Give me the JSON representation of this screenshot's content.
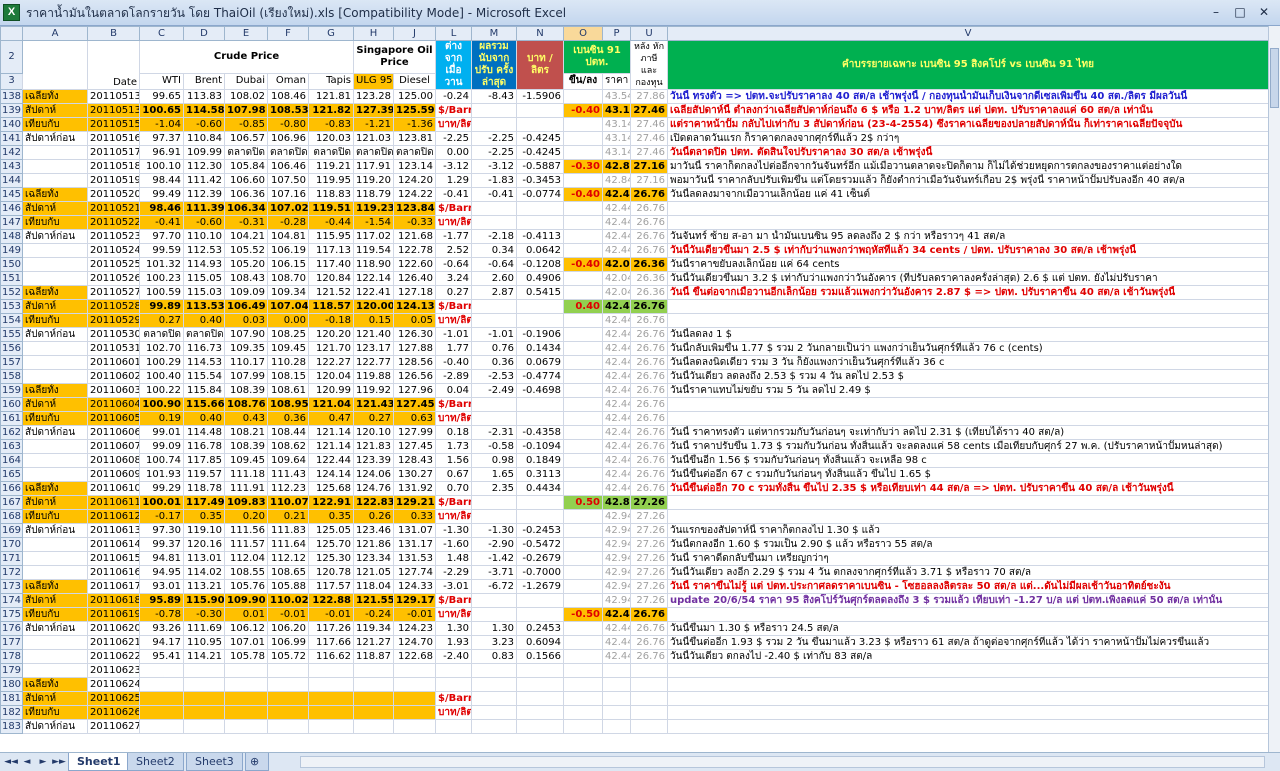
{
  "window": {
    "title": "ราคาน้ำมันในตลาดโลกรายวัน โดย ThaiOil (เรียงใหม่).xls  [Compatibility Mode] - Microsoft Excel",
    "app_icon": "X",
    "minimize": "–",
    "maximize": "□",
    "close": "✕"
  },
  "columns": [
    "A",
    "B",
    "C",
    "D",
    "E",
    "F",
    "G",
    "H",
    "J",
    "L",
    "M",
    "N",
    "O",
    "P",
    "U",
    "V"
  ],
  "header": {
    "r2": "2",
    "r3": "3",
    "crude": "Crude Price",
    "singapore": "Singapore Oil Price",
    "date": "Date",
    "wti": "WTI",
    "brent": "Brent",
    "dubai": "Dubai",
    "oman": "Oman",
    "tapis": "Tapis",
    "ulg": "ULG 95",
    "diesel": "Diesel",
    "diff": "ต่าง จาก เมื่อ วาน",
    "cum": "ผลรวม นับจาก ปรับ ครั้ง ล่าสุด",
    "baht": "บาท / ลิตร",
    "b91": "เบนซิน 91 ปตท.",
    "updown": "ขึ้น/ลง",
    "price": "ราคา",
    "u": "หลัง หัก ภาษี และ กองทุน",
    "v": "คำบรรยายเฉพาะ เบนซิน 95 สิงคโปร์ vs เบนซิน 91 ไทย"
  },
  "rows": [
    [
      "138",
      "เฉลี่ยทั้ง",
      "20110513",
      "99.65",
      "113.83",
      "108.02",
      "108.46",
      "121.81",
      "123.28",
      "125.00",
      "-0.24",
      "-8.43",
      "-1.5906",
      "",
      "43.54",
      "27.86",
      "วันนี้ ทรงตัว => ปตท.จะปรับราคาลง 40 สต/ล เช้าพรุ่งนี้ / กองทุนน้ำมันเก็บเงินจากดีเซลเพิ่มขึ้น 40 สต./ลิตร มีผลวันนี้"
    ],
    [
      "139",
      "สัปดาห์",
      "20110513",
      "100.65",
      "114.58",
      "107.98",
      "108.53",
      "121.82",
      "127.39",
      "125.59",
      "$/Barrel",
      "",
      "",
      "-0.40",
      "43.14",
      "27.46",
      "เฉลี่ยสัปดาห์นี้ ต่ำลงกว่าเฉลี่ยสัปดาห์ก่อนถึง 6 $ หรือ 1.2 บาท/ลิตร แต่ ปตท. ปรับราคาลงแค่ 60 สต/ล เท่านั้น"
    ],
    [
      "140",
      "เทียบกับ",
      "20110515",
      "-1.04",
      "-0.60",
      "-0.85",
      "-0.80",
      "-0.83",
      "-1.21",
      "-1.36",
      "บาท/ลิตร",
      "",
      "",
      "",
      "43.14",
      "27.46",
      "แต่ราคาหน้าปั๊ม กลับไปเท่ากับ 3 สัปดาห์ก่อน (23-4-2554) ซึ่งราคาเฉลี่ยของปลายสัปดาห์นั้น ก็เท่าราคาเฉลี่ยปัจจุบัน"
    ],
    [
      "141",
      "สัปดาห์ก่อน",
      "20110516",
      "97.37",
      "110.84",
      "106.57",
      "106.96",
      "120.03",
      "121.03",
      "123.81",
      "-2.25",
      "-2.25",
      "-0.4245",
      "",
      "43.14",
      "27.46",
      "เปิดตลาดวันแรก ก็ราคาตกลงจากศุกร์ที่แล้ว 2$ กว่าๆ"
    ],
    [
      "142",
      "",
      "20110517",
      "96.91",
      "109.99",
      "ตลาดปิด",
      "ตลาดปิด",
      "ตลาดปิด",
      "ตลาดปิด",
      "ตลาดปิด",
      "0.00",
      "-2.25",
      "-0.4245",
      "",
      "43.14",
      "27.46",
      "วันนี้ตลาดปิด  ปตท. ตัดสินใจปรับราคาลง 30 สต/ล เช้าพรุ่งนี้"
    ],
    [
      "143",
      "",
      "20110518",
      "100.10",
      "112.30",
      "105.84",
      "106.46",
      "119.21",
      "117.91",
      "123.14",
      "-3.12",
      "-3.12",
      "-0.5887",
      "-0.30",
      "42.84",
      "27.16",
      "มาวันนี้ ราคาก็ตกลงไปต่ออีกจากวันจันทร์อีก แม้เมื่อวานตลาดจะปิดก็ตาม ก็ไม่ได้ช่วยหยุดการตกลงของราคาแต่อย่างใด"
    ],
    [
      "144",
      "",
      "20110519",
      "98.44",
      "111.42",
      "106.60",
      "107.50",
      "119.95",
      "119.20",
      "124.20",
      "1.29",
      "-1.83",
      "-0.3453",
      "",
      "42.84",
      "27.16",
      "พอมาวันนี้ ราคากลับปรับเพิ่มขึ้น แต่โดยรวมแล้ว ก็ยังต่ำกว่าเมื่อวันจันทร์เกือบ 2$  พรุ่งนี้ ราคาหน้าปั๊มปรับลงอีก 40 สต/ล"
    ],
    [
      "145",
      "เฉลี่ยทั้ง",
      "20110520",
      "99.49",
      "112.39",
      "106.36",
      "107.16",
      "118.83",
      "118.79",
      "124.22",
      "-0.41",
      "-0.41",
      "-0.0774",
      "-0.40",
      "42.44",
      "26.76",
      "วันนี้ลดลงมาจากเมื่อวานเล็กน้อย แค่ 41 เซ็นต์"
    ],
    [
      "146",
      "สัปดาห์",
      "20110521",
      "98.46",
      "111.39",
      "106.34",
      "107.02",
      "119.51",
      "119.23",
      "123.84",
      "$/Barrel",
      "",
      "",
      "",
      "42.44",
      "26.76",
      ""
    ],
    [
      "147",
      "เทียบกับ",
      "20110522",
      "-0.41",
      "-0.60",
      "-0.31",
      "-0.28",
      "-0.44",
      "-1.54",
      "-0.33",
      "บาท/ลิตร",
      "",
      "",
      "",
      "42.44",
      "26.76",
      ""
    ],
    [
      "148",
      "สัปดาห์ก่อน",
      "20110523",
      "97.70",
      "110.10",
      "104.21",
      "104.81",
      "115.95",
      "117.02",
      "121.68",
      "-1.77",
      "-2.18",
      "-0.4113",
      "",
      "42.44",
      "26.76",
      "วันจันทร์ ซ้าย ส-อา มา น้ำมันเบนซิน 95 ลดลงถึง 2 $ กว่า หรือราวๆ 41 สต/ล"
    ],
    [
      "149",
      "",
      "20110524",
      "99.59",
      "112.53",
      "105.52",
      "106.19",
      "117.13",
      "119.54",
      "122.78",
      "2.52",
      "0.34",
      "0.0642",
      "",
      "42.44",
      "26.76",
      "วันนี้วันเดียวขึ้นมา 2.5 $ เท่ากับว่าแพงกว่าพฤหัสที่แล้ว 34 cents / ปตท. ปรับราคาลง 30 สต/ล เช้าพรุ่งนี้"
    ],
    [
      "150",
      "",
      "20110525",
      "101.32",
      "114.93",
      "105.20",
      "106.15",
      "117.40",
      "118.90",
      "122.60",
      "-0.64",
      "-0.64",
      "-0.1208",
      "-0.40",
      "42.04",
      "26.36",
      "วันนี้ราคาขยับลงเล็กน้อย แค่ 64 cents"
    ],
    [
      "151",
      "",
      "20110526",
      "100.23",
      "115.05",
      "108.43",
      "108.70",
      "120.84",
      "122.14",
      "126.40",
      "3.24",
      "2.60",
      "0.4906",
      "",
      "42.04",
      "26.36",
      "วันนี้วันเดียวขึ้นมา 3.2 $ เท่ากับว่าแพงกว่าวันอังคาร (ที่ปรับลดราคาลงครั้งล่าสุด) 2.6 $ แต่ ปตท. ยังไม่ปรับราคา"
    ],
    [
      "152",
      "เฉลี่ยทั้ง",
      "20110527",
      "100.59",
      "115.03",
      "109.09",
      "109.34",
      "121.52",
      "122.41",
      "127.18",
      "0.27",
      "2.87",
      "0.5415",
      "",
      "42.04",
      "26.36",
      "วันนี้ ขึ้นต่อจากเมื่อวานอีกเล็กน้อย รวมแล้วแพงกว่าวันอังคาร 2.87 $ => ปตท. ปรับราคาขึ้น 40 สต/ล เช้าวันพรุ่งนี้"
    ],
    [
      "153",
      "สัปดาห์",
      "20110528",
      "99.89",
      "113.53",
      "106.49",
      "107.04",
      "118.57",
      "120.00",
      "124.13",
      "$/Barrel",
      "",
      "",
      "0.40",
      "42.44",
      "26.76",
      ""
    ],
    [
      "154",
      "เทียบกับ",
      "20110529",
      "0.27",
      "0.40",
      "0.03",
      "0.00",
      "-0.18",
      "0.15",
      "0.05",
      "บาท/ลิตร",
      "",
      "",
      "",
      "42.44",
      "26.76",
      ""
    ],
    [
      "155",
      "สัปดาห์ก่อน",
      "20110530",
      "ตลาดปิด",
      "ตลาดปิด",
      "107.90",
      "108.25",
      "120.20",
      "121.40",
      "126.30",
      "-1.01",
      "-1.01",
      "-0.1906",
      "",
      "42.44",
      "26.76",
      "วันนี้ลดลง 1 $"
    ],
    [
      "156",
      "",
      "20110531",
      "102.70",
      "116.73",
      "109.35",
      "109.45",
      "121.70",
      "123.17",
      "127.88",
      "1.77",
      "0.76",
      "0.1434",
      "",
      "42.44",
      "26.76",
      "วันนี้กลับเพิ่มขึ้น 1.77 $ รวม 2 วันกลายเป็นว่า แพงกว่าเย็นวันศุกร์ที่แล้ว 76 c (cents)"
    ],
    [
      "157",
      "",
      "20110601",
      "100.29",
      "114.53",
      "110.17",
      "110.28",
      "122.27",
      "122.77",
      "128.56",
      "-0.40",
      "0.36",
      "0.0679",
      "",
      "42.44",
      "26.76",
      "วันนี้ลดลงนิดเดียว รวม 3 วัน ก็ยังแพงกว่าเย็นวันศุกร์ที่แล้ว 36 c"
    ],
    [
      "158",
      "",
      "20110602",
      "100.40",
      "115.54",
      "107.99",
      "108.15",
      "120.04",
      "119.88",
      "126.56",
      "-2.89",
      "-2.53",
      "-0.4774",
      "",
      "42.44",
      "26.76",
      "วันนี้วันเดียว ลดลงถึง 2.53 $ รวม 4 วัน ลดไป 2.53 $"
    ],
    [
      "159",
      "เฉลี่ยทั้ง",
      "20110603",
      "100.22",
      "115.84",
      "108.39",
      "108.61",
      "120.99",
      "119.92",
      "127.96",
      "0.04",
      "-2.49",
      "-0.4698",
      "",
      "42.44",
      "26.76",
      "วันนี้ราคาแทบไม่ขยับ  รวม 5 วัน ลดไป 2.49 $"
    ],
    [
      "160",
      "สัปดาห์",
      "20110604",
      "100.90",
      "115.66",
      "108.76",
      "108.95",
      "121.04",
      "121.43",
      "127.45",
      "$/Barrel",
      "",
      "",
      "",
      "42.44",
      "26.76",
      ""
    ],
    [
      "161",
      "เทียบกับ",
      "20110605",
      "0.19",
      "0.40",
      "0.43",
      "0.36",
      "0.47",
      "0.27",
      "0.63",
      "บาท/ลิตร",
      "",
      "",
      "",
      "42.44",
      "26.76",
      ""
    ],
    [
      "162",
      "สัปดาห์ก่อน",
      "20110606",
      "99.01",
      "114.48",
      "108.21",
      "108.44",
      "121.14",
      "120.10",
      "127.99",
      "0.18",
      "-2.31",
      "-0.4358",
      "",
      "42.44",
      "26.76",
      "วันนี้ ราคาทรงตัว แต่หากรวมกับวันก่อนๆ จะเท่ากับว่า ลดไป 2.31 $ (เทียบได้ราว 40 สต/ล)"
    ],
    [
      "163",
      "",
      "20110607",
      "99.09",
      "116.78",
      "108.39",
      "108.62",
      "121.14",
      "121.83",
      "127.45",
      "1.73",
      "-0.58",
      "-0.1094",
      "",
      "42.44",
      "26.76",
      "วันนี้ ราคาปรับขึ้น 1.73 $ รวมกับวันก่อน ทั้งสิ้นแล้ว จะลดลงแค่ 58 cents เมื่อเทียบกับศุกร์ 27 พ.ค. (ปรับราคาหน้าปั๊มหนล่าสุด)"
    ],
    [
      "164",
      "",
      "20110608",
      "100.74",
      "117.85",
      "109.45",
      "109.64",
      "122.44",
      "123.39",
      "128.43",
      "1.56",
      "0.98",
      "0.1849",
      "",
      "42.44",
      "26.76",
      "วันนี้ขึ้นอีก 1.56 $ รวมกับวันก่อนๆ ทั้งสิ้นแล้ว จะเหลือ 98 c"
    ],
    [
      "165",
      "",
      "20110609",
      "101.93",
      "119.57",
      "111.18",
      "111.43",
      "124.14",
      "124.06",
      "130.27",
      "0.67",
      "1.65",
      "0.3113",
      "",
      "42.44",
      "26.76",
      "วันนี้ขึ้นต่ออีก 67 c  รวมกับวันก่อนๆ ทั้งสิ้นแล้ว ขึ้นไป 1.65 $"
    ],
    [
      "166",
      "เฉลี่ยทั้ง",
      "20110610",
      "99.29",
      "118.78",
      "111.91",
      "112.23",
      "125.68",
      "124.76",
      "131.92",
      "0.70",
      "2.35",
      "0.4434",
      "",
      "42.44",
      "26.76",
      "วันนี้ขึ้นต่ออีก 70 c  รวมทั้งสิ้น ขึ้นไป 2.35 $ หรือเทียบเท่า 44 สต/ล => ปตท. ปรับราคาขึ้น 40 สต/ล เช้าวันพรุ่งนี้"
    ],
    [
      "167",
      "สัปดาห์",
      "20110611",
      "100.01",
      "117.49",
      "109.83",
      "110.07",
      "122.91",
      "122.83",
      "129.21",
      "$/Barrel",
      "",
      "",
      "0.50",
      "42.84",
      "27.26",
      ""
    ],
    [
      "168",
      "เทียบกับ",
      "20110612",
      "-0.17",
      "0.35",
      "0.20",
      "0.21",
      "0.35",
      "0.26",
      "0.33",
      "บาท/ลิตร",
      "",
      "",
      "",
      "42.94",
      "27.26",
      ""
    ],
    [
      "169",
      "สัปดาห์ก่อน",
      "20110613",
      "97.30",
      "119.10",
      "111.56",
      "111.83",
      "125.05",
      "123.46",
      "131.07",
      "-1.30",
      "-1.30",
      "-0.2453",
      "",
      "42.94",
      "27.26",
      "วันแรกของสัปดาห์นี้ ราคาก็ตกลงไป 1.30 $ แล้ว"
    ],
    [
      "170",
      "",
      "20110614",
      "99.37",
      "120.16",
      "111.57",
      "111.64",
      "125.70",
      "121.86",
      "131.17",
      "-1.60",
      "-2.90",
      "-0.5472",
      "",
      "42.94",
      "27.26",
      "วันนี้ตกลงอีก 1.60 $ รวมเป็น 2.90 $ แล้ว หรือราว 55 สต/ล"
    ],
    [
      "171",
      "",
      "20110615",
      "94.81",
      "113.01",
      "112.04",
      "112.12",
      "125.30",
      "123.34",
      "131.53",
      "1.48",
      "-1.42",
      "-0.2679",
      "",
      "42.94",
      "27.26",
      "วันนี้ ราคาดีดกลับขึ้นมา เหรียญกว่าๆ"
    ],
    [
      "172",
      "",
      "20110616",
      "94.95",
      "114.02",
      "108.55",
      "108.65",
      "120.78",
      "121.05",
      "127.74",
      "-2.29",
      "-3.71",
      "-0.7000",
      "",
      "42.94",
      "27.26",
      "วันนี้วันเดียว ลงอีก 2.29 $ รวม 4 วัน ตกลงจากศุกร์ที่แล้ว 3.71 $ หรือราว 70 สต/ล"
    ],
    [
      "173",
      "เฉลี่ยทั้ง",
      "20110617",
      "93.01",
      "113.21",
      "105.76",
      "105.88",
      "117.57",
      "118.04",
      "124.33",
      "-3.01",
      "-6.72",
      "-1.2679",
      "",
      "42.94",
      "27.26",
      "วันนี้ ราคาขึ้นไม่รู้ แต่ ปตท.ประกาศลดราคาเบนซิน - โซฮอลลงลิตรละ 50 สต/ล แต่...ดันไม่มีผลเช้าวันอาทิตย์ชะงัน"
    ],
    [
      "174",
      "สัปดาห์",
      "20110618",
      "95.89",
      "115.90",
      "109.90",
      "110.02",
      "122.88",
      "121.55",
      "129.17",
      "$/Barrel",
      "",
      "",
      "",
      "42.94",
      "27.26",
      "update 20/6/54 ราคา 95 สิงคโปร์วันศุกร์ตลดลงถึง 3 $ รวมแล้ว เทียบเท่า -1.27 บ/ล แต่ ปตท.เพิ่งลดแค่ 50 สต/ล เท่านั้น"
    ],
    [
      "175",
      "เทียบกับ",
      "20110619",
      "-0.78",
      "-0.30",
      "0.01",
      "-0.01",
      "-0.01",
      "-0.24",
      "-0.01",
      "บาท/ลิตร",
      "",
      "",
      "-0.50",
      "42.44",
      "26.76",
      ""
    ],
    [
      "176",
      "สัปดาห์ก่อน",
      "20110620",
      "93.26",
      "111.69",
      "106.12",
      "106.20",
      "117.26",
      "119.34",
      "124.23",
      "1.30",
      "1.30",
      "0.2453",
      "",
      "42.44",
      "26.76",
      "วันนี้ขึ้นมา 1.30 $ หรือราว 24.5 สต/ล"
    ],
    [
      "177",
      "",
      "20110621",
      "94.17",
      "110.95",
      "107.01",
      "106.99",
      "117.66",
      "121.27",
      "124.70",
      "1.93",
      "3.23",
      "0.6094",
      "",
      "42.44",
      "26.76",
      "วันนี้ขึ้นต่ออีก 1.93 $ รวม 2 วัน ขึ้นมาแล้ว 3.23 $ หรือราว 61 สต/ล ถ้าดูต่อจากศุกร์ที่แล้ว ได้ว่า ราคาหน้าปั๊มไม่ควรขึ้นแล้ว"
    ],
    [
      "178",
      "",
      "20110622",
      "95.41",
      "114.21",
      "105.78",
      "105.72",
      "116.62",
      "118.87",
      "122.68",
      "-2.40",
      "0.83",
      "0.1566",
      "",
      "42.44",
      "26.76",
      "วันนี้วันเดียว ตกลงไป -2.40 $ เท่ากับ 83 สต/ล"
    ],
    [
      "179",
      "",
      "20110623",
      "",
      "",
      "",
      "",
      "",
      "",
      "",
      "",
      "",
      "",
      "",
      "",
      "",
      ""
    ],
    [
      "180",
      "เฉลี่ยทั้ง",
      "20110624",
      "",
      "",
      "",
      "",
      "",
      "",
      "",
      "",
      "",
      "",
      "",
      "",
      "",
      ""
    ],
    [
      "181",
      "สัปดาห์",
      "20110625",
      "",
      "",
      "",
      "",
      "",
      "",
      "",
      "$/Barrel",
      "",
      "",
      "",
      "",
      "",
      ""
    ],
    [
      "182",
      "เทียบกับ",
      "20110626",
      "",
      "",
      "",
      "",
      "",
      "",
      "",
      "บาท/ลิตร",
      "",
      "",
      "",
      "",
      "",
      ""
    ],
    [
      "183",
      "สัปดาห์ก่อน",
      "20110627",
      "",
      "",
      "",
      "",
      "",
      "",
      "",
      "",
      "",
      "",
      "",
      "",
      "",
      ""
    ]
  ],
  "tabs": [
    "Sheet1",
    "Sheet2",
    "Sheet3"
  ],
  "tab_nav": [
    "◄◄",
    "◄",
    "►",
    "►►"
  ]
}
